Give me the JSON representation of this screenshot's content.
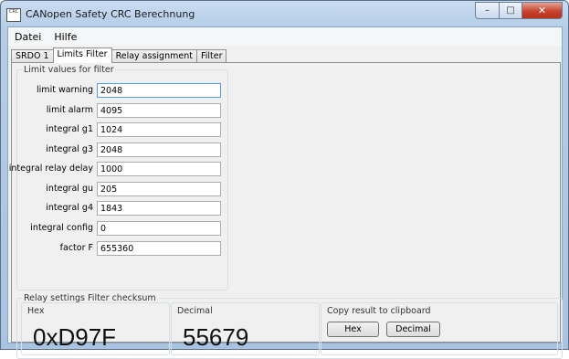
{
  "window": {
    "title": "CANopen Safety CRC Berechnung",
    "icon_text": "CRC"
  },
  "menu": [
    "Datei",
    "Hilfe"
  ],
  "tabs": [
    "SRDO 1",
    "Limits Filter",
    "Relay assignment",
    "Filter"
  ],
  "active_tab": "Limits Filter",
  "limits": {
    "legend": "Limit values for filter",
    "fields": [
      {
        "label": "limit warning",
        "value": "2048"
      },
      {
        "label": "limit alarm",
        "value": "4095"
      },
      {
        "label": "integral g1",
        "value": "1024"
      },
      {
        "label": "integral g3",
        "value": "2048"
      },
      {
        "label": "integral relay delay",
        "value": "1000"
      },
      {
        "label": "integral gu",
        "value": "205"
      },
      {
        "label": "integral g4",
        "value": "1843"
      },
      {
        "label": "integral config",
        "value": "0"
      },
      {
        "label": "factor F",
        "value": "655360"
      }
    ]
  },
  "checksum": {
    "legend": "Relay settings Filter checksum",
    "hex_label": "Hex",
    "hex_value": "0xD97F",
    "decimal_label": "Decimal",
    "decimal_value": "55679",
    "copy_label": "Copy result to clipboard",
    "copy_hex_button": "Hex",
    "copy_decimal_button": "Decimal"
  }
}
